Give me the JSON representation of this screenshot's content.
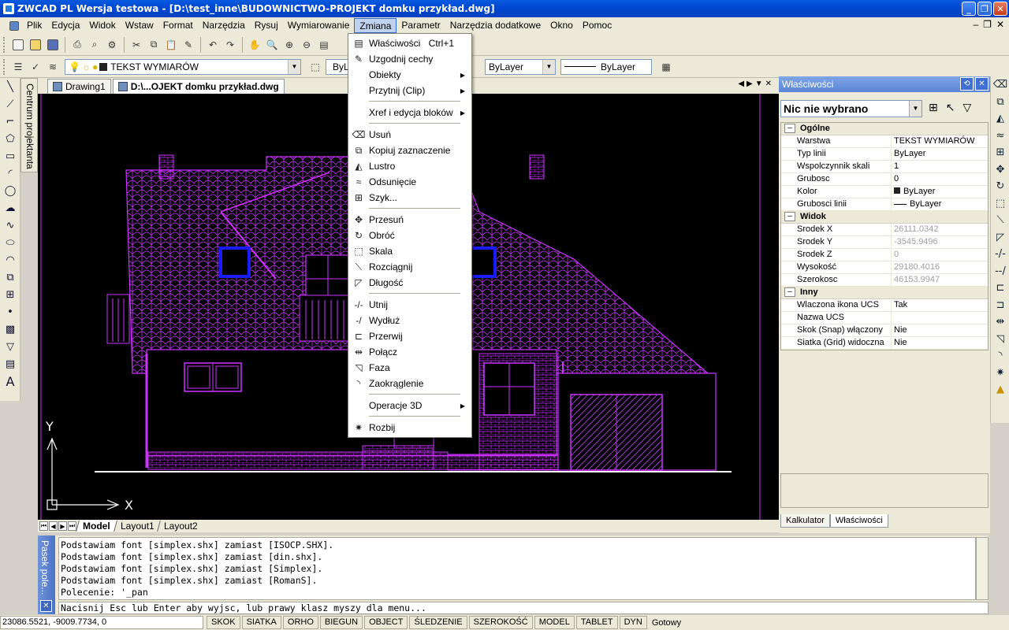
{
  "window": {
    "title": "ZWCAD PL Wersja testowa - [D:\\test_inne\\BUDOWNICTWO-PROJEKT domku przykład.dwg]"
  },
  "menubar": {
    "items": [
      "Plik",
      "Edycja",
      "Widok",
      "Wstaw",
      "Format",
      "Narzędzia",
      "Rysuj",
      "Wymiarowanie",
      "Zmiana",
      "Parametr",
      "Narzędzia dodatkowe",
      "Okno",
      "Pomoc"
    ],
    "active": "Zmiana"
  },
  "toolbar2": {
    "layer": "TEKST WYMIARÓW",
    "color": "ByLayer",
    "linetype": "ByLayer",
    "lineweight": "ByLayer"
  },
  "sidepanel": {
    "label": "Centrum projektanta"
  },
  "doctabs": [
    {
      "label": "Drawing1"
    },
    {
      "label": "D:\\...OJEKT domku przykład.dwg"
    }
  ],
  "layouts": [
    "Model",
    "Layout1",
    "Layout2"
  ],
  "dropdown": {
    "groups": [
      [
        {
          "label": "Właściwości",
          "shortcut": "Ctrl+1",
          "icon": "properties-icon"
        },
        {
          "label": "Uzgodnij cechy",
          "icon": "match-properties-icon"
        },
        {
          "label": "Obiekty",
          "submenu": true
        },
        {
          "label": "Przytnij (Clip)",
          "submenu": true
        }
      ],
      [
        {
          "label": "Xref i edycja bloków",
          "submenu": true
        }
      ],
      [
        {
          "label": "Usuń",
          "icon": "erase-icon"
        },
        {
          "label": "Kopiuj zaznaczenie",
          "icon": "copy-icon"
        },
        {
          "label": "Lustro",
          "icon": "mirror-icon"
        },
        {
          "label": "Odsunięcie",
          "icon": "offset-icon"
        },
        {
          "label": "Szyk...",
          "icon": "array-icon"
        }
      ],
      [
        {
          "label": "Przesuń",
          "icon": "move-icon"
        },
        {
          "label": "Obróć",
          "icon": "rotate-icon"
        },
        {
          "label": "Skala",
          "icon": "scale-icon"
        },
        {
          "label": "Rozciągnij",
          "icon": "stretch-icon"
        },
        {
          "label": "Długość",
          "icon": "lengthen-icon"
        }
      ],
      [
        {
          "label": "Utnij",
          "icon": "trim-icon"
        },
        {
          "label": "Wydłuż",
          "icon": "extend-icon"
        },
        {
          "label": "Przerwij",
          "icon": "break-icon"
        },
        {
          "label": "Połącz",
          "icon": "join-icon"
        },
        {
          "label": "Faza",
          "icon": "chamfer-icon"
        },
        {
          "label": "Zaokrąglenie",
          "icon": "fillet-icon"
        }
      ],
      [
        {
          "label": "Operacje 3D",
          "submenu": true
        }
      ],
      [
        {
          "label": "Rozbij",
          "icon": "explode-icon"
        }
      ]
    ]
  },
  "properties": {
    "title": "Właściwości",
    "selection": "Nic nie wybrano",
    "categories": [
      {
        "name": "Ogólne",
        "rows": [
          [
            "Warstwa",
            "TEKST WYMIARÓW"
          ],
          [
            "Typ linii",
            "ByLayer"
          ],
          [
            "Wspolczynnik skali",
            "1"
          ],
          [
            "Grubosc",
            "0"
          ],
          [
            "Kolor",
            "ByLayer"
          ],
          [
            "Grubosci linii",
            "ByLayer"
          ]
        ]
      },
      {
        "name": "Widok",
        "rows": [
          [
            "Srodek X",
            "26111.0342"
          ],
          [
            "Srodek Y",
            "-3545.9496"
          ],
          [
            "Srodek Z",
            "0"
          ],
          [
            "Wysokość",
            "29180.4016"
          ],
          [
            "Szerokosc",
            "46153.9947"
          ]
        ]
      },
      {
        "name": "Inny",
        "rows": [
          [
            "Wlaczona ikona UCS",
            "Tak"
          ],
          [
            "Nazwa UCS",
            ""
          ],
          [
            "Skok (Snap) włączony",
            "Nie"
          ],
          [
            "Siatka (Grid) widoczna",
            "Nie"
          ]
        ]
      }
    ],
    "tabs": [
      "Kalkulator",
      "Właściwości"
    ]
  },
  "command": {
    "side_label": "Pasek pole...",
    "log": [
      "Podstawiam font [simplex.shx] zamiast [ISOCP.SHX].",
      "Podstawiam font [simplex.shx] zamiast [din.shx].",
      "Podstawiam font [simplex.shx] zamiast [Simplex].",
      "Podstawiam font [simplex.shx] zamiast [RomanS].",
      "Polecenie: '_pan"
    ],
    "prompt": "Nacisnij Esc lub Enter aby wyjsc, lub prawy klasz myszy dla menu..."
  },
  "status": {
    "coords": "23086.5521,  -9009.7734,  0",
    "buttons": [
      "SKOK",
      "SIATKA",
      "ORHO",
      "BIEGUN",
      "OBJECT",
      "ŚLEDZENIE",
      "SZEROKOŚĆ",
      "MODEL",
      "TABLET",
      "DYN"
    ],
    "ready": "Gotowy"
  },
  "ucs": {
    "x": "X",
    "y": "Y"
  },
  "colors": {
    "drawing": "#cc33ff",
    "window_blue": "#1b1bff",
    "canvas_bg": "#000000"
  }
}
